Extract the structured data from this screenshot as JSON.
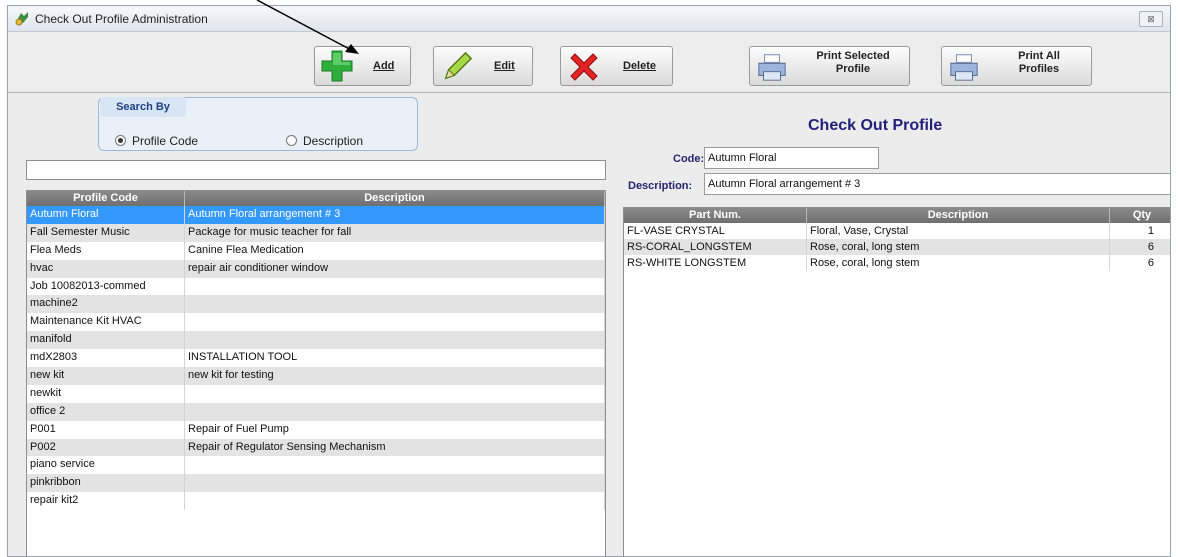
{
  "window": {
    "title": "Check Out Profile Administration",
    "close_label": "⊠"
  },
  "toolbar": {
    "add_label": "Add",
    "edit_label": "Edit",
    "delete_label": "Delete",
    "print_selected_line1": "Print Selected",
    "print_selected_line2": "Profile",
    "print_all_line1": "Print All",
    "print_all_line2": "Profiles"
  },
  "search": {
    "group_label": "Search By",
    "option_code": "Profile Code",
    "option_description": "Description",
    "selected": "Profile Code",
    "value": ""
  },
  "profile_list": {
    "columns": [
      "Profile Code",
      "Description"
    ],
    "rows": [
      [
        "Autumn Floral",
        "Autumn Floral arrangement # 3"
      ],
      [
        "Fall Semester Music",
        "Package for music teacher for fall"
      ],
      [
        "Flea Meds",
        "Canine Flea Medication"
      ],
      [
        "hvac",
        "repair air conditioner window"
      ],
      [
        "Job 10082013-commed",
        ""
      ],
      [
        "machine2",
        ""
      ],
      [
        "Maintenance Kit HVAC",
        ""
      ],
      [
        "manifold",
        ""
      ],
      [
        "mdX2803",
        "INSTALLATION TOOL"
      ],
      [
        "new kit",
        "new kit for testing"
      ],
      [
        "newkit",
        ""
      ],
      [
        "office 2",
        ""
      ],
      [
        "P001",
        "Repair of Fuel Pump"
      ],
      [
        "P002",
        "Repair of Regulator Sensing Mechanism"
      ],
      [
        "piano service",
        ""
      ],
      [
        "pinkribbon",
        ""
      ],
      [
        "repair kit2",
        ""
      ]
    ],
    "selected_index": 0
  },
  "profile": {
    "heading": "Check Out Profile",
    "code_label": "Code:",
    "code_value": "Autumn Floral",
    "description_label": "Description:",
    "description_value": "Autumn Floral arrangement # 3"
  },
  "parts": {
    "columns": [
      "Part Num.",
      "Description",
      "Qty"
    ],
    "rows": [
      [
        "FL-VASE CRYSTAL",
        "Floral, Vase, Crystal",
        "1"
      ],
      [
        "RS-CORAL_LONGSTEM",
        "Rose, coral, long stem",
        "6"
      ],
      [
        "RS-WHITE LONGSTEM",
        "Rose, coral, long stem",
        "6"
      ]
    ]
  },
  "icons": {
    "app": "money-icon",
    "add": "green-plus-icon",
    "edit": "pencil-icon",
    "delete": "red-x-icon",
    "print": "printer-icon"
  },
  "colors": {
    "selection": "#3399ff",
    "heading": "#20207a",
    "header_bg": "#7a7a7a"
  }
}
